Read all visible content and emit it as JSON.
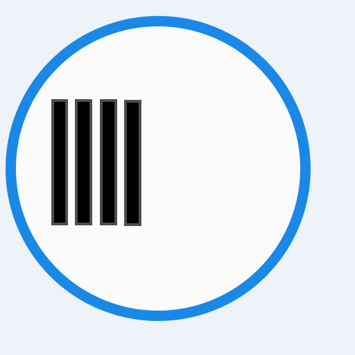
{
  "colors": {
    "background": "#eef3fa",
    "ring": "#1a88e6",
    "disc_fill": "#fcfbfc",
    "bar_fill": "#000000",
    "bar_outline": "#4e4e4e"
  },
  "icon": {
    "name": "four-vertical-bars-in-circle-icon",
    "bar_count": 4
  }
}
